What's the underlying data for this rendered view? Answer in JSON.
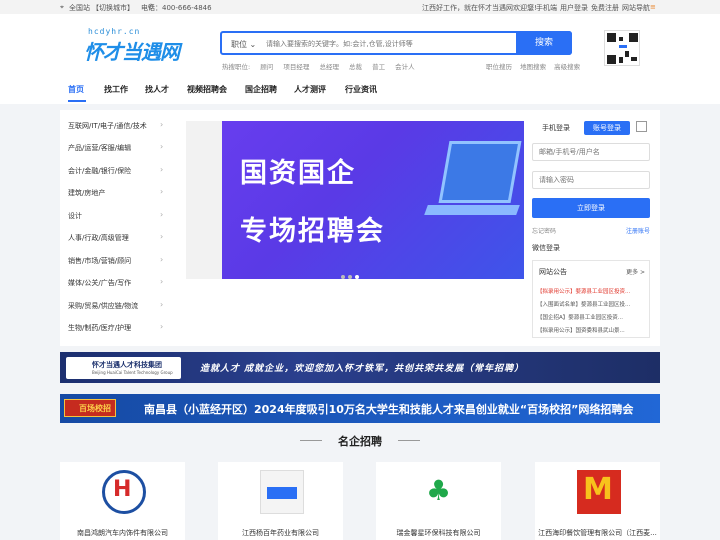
{
  "topbar": {
    "location": "全国站",
    "switch_city": "【切换城市】",
    "phone": "电话：400-666-4846",
    "welcome": "江西好工作，就在怀才当遇网欢迎您!",
    "mobile": "手机端",
    "login": "用户登录",
    "register": "免费注册",
    "site_nav": "网站导航"
  },
  "logo": {
    "subtitle": "hcdyhr.cn",
    "main": "怀才当遇网"
  },
  "search": {
    "category": "职位",
    "placeholder": "请输入要搜索的关键字。如:会计,仓管,设计师等",
    "button": "搜索",
    "hot_label": "热搜职位:",
    "hot_items": [
      "顾问",
      "项目经理",
      "总经理",
      "总裁",
      "普工",
      "会计人"
    ],
    "links": [
      "职位搜历",
      "地图搜索",
      "高级搜索"
    ]
  },
  "nav": {
    "items": [
      "首页",
      "找工作",
      "找人才",
      "视频招聘会",
      "国企招聘",
      "人才测评",
      "行业资讯"
    ],
    "active": 0
  },
  "categories": [
    "互联网/IT/电子/通信/技术",
    "产品/运营/客服/编辑",
    "会计/金融/银行/保险",
    "建筑/房地产",
    "设计",
    "人事/行政/高级管理",
    "销售/市场/营销/顾问",
    "媒体/公关/广告/写作",
    "采购/贸易/供应链/物流",
    "生物/制药/医疗/护理"
  ],
  "banner": {
    "line1": "国资国企",
    "line2": "专场招聘会"
  },
  "login": {
    "tab_phone": "手机登录",
    "tab_account": "账号登录",
    "username_placeholder": "邮箱/手机号/用户名",
    "password_placeholder": "请输入密码",
    "submit": "立即登录",
    "forgot": "忘记密码",
    "register": "注册账号",
    "wechat": "微信登录"
  },
  "notices": {
    "title": "网站公告",
    "more": "更多 >",
    "items": [
      "【拟录用公示】婺源县工业园区投资...",
      "【入围面试名单】婺源县工业园区投...",
      "【国企招A】婺源县工业园区投资...",
      "【拟录用公示】国资委和县武山景..."
    ]
  },
  "strips": {
    "strip1_logo": "怀才当遇人才科技集团",
    "strip1_logo_en": "Beijing HuaiCai Talent Technology Group",
    "strip1_text": "造就人才  成就企业，欢迎您加入怀才铁军，共创共荣共发展（常年招聘）",
    "strip2_logo": "百场校招",
    "strip2_text": "南昌县（小蓝经开区）2024年度吸引10万名大学生和技能人才来昌创业就业“百场校招”网络招聘会"
  },
  "companies": {
    "title": "名企招聘",
    "items": [
      "南昌鸿朗汽车内饰件有限公司",
      "江西杨百年药业有限公司",
      "瑞金馨星环保科技有限公司",
      "江西海印餐饮管理有限公司（江西麦..."
    ]
  },
  "colors": {
    "accent": "#2a6ff5",
    "notice_red": "#e0352a"
  }
}
